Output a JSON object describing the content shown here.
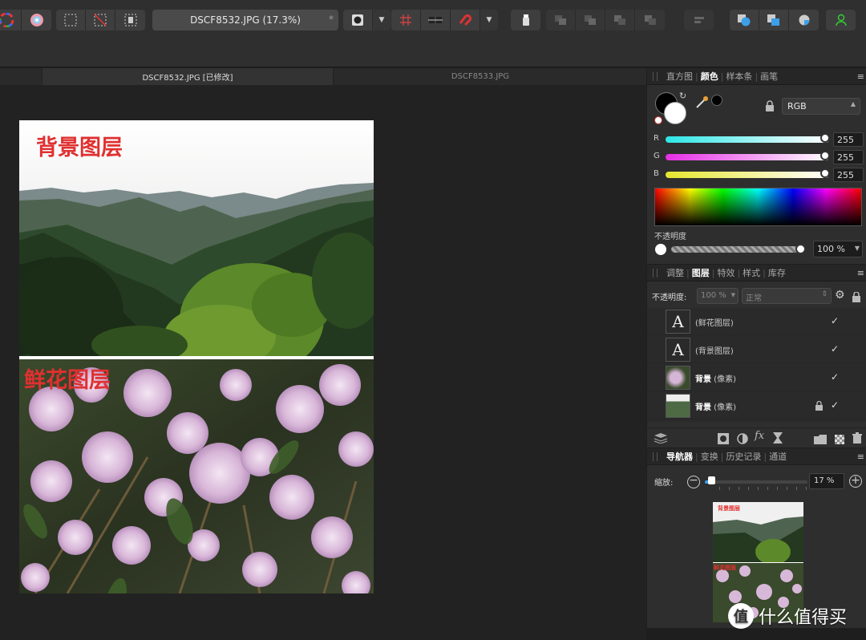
{
  "toolbar": {
    "document_title": "DSCF8532.JPG (17.3%)",
    "modified_mark": "*"
  },
  "tabs": [
    {
      "label": "DSCF8532.JPG [已修改]",
      "active": true
    },
    {
      "label": "DSCF8533.JPG",
      "active": false
    }
  ],
  "canvas": {
    "top_text_layer": "背景图层",
    "bottom_text_layer": "鲜花图层"
  },
  "color_panel": {
    "tabs": [
      "直方图",
      "颜色",
      "样本条",
      "画笔"
    ],
    "active_tab": "颜色",
    "mode": "RGB",
    "channels": [
      {
        "label": "R",
        "value": "255",
        "color": "#2ee6e6"
      },
      {
        "label": "G",
        "value": "255",
        "color": "#e62ee6"
      },
      {
        "label": "B",
        "value": "255",
        "color": "#e6e62e"
      }
    ],
    "opacity_label": "不透明度",
    "opacity_value": "100 %"
  },
  "layers_panel": {
    "tabs": [
      "调整",
      "图层",
      "特效",
      "样式",
      "库存"
    ],
    "active_tab": "图层",
    "opacity_label": "不透明度:",
    "opacity_value": "100 %",
    "blend_mode": "正常",
    "layers": [
      {
        "thumb": "A",
        "name": "(鲜花图层)",
        "type": "text",
        "visible": "✓",
        "locked": false
      },
      {
        "thumb": "A",
        "name": "(背景图层)",
        "type": "text",
        "visible": "✓",
        "locked": false
      },
      {
        "thumb": "",
        "bold": "背景",
        "name": " (像素)",
        "type": "flower",
        "visible": "✓",
        "locked": false
      },
      {
        "thumb": "",
        "bold": "背景",
        "name": " (像素)",
        "type": "mountain",
        "visible": "✓",
        "locked": true
      }
    ]
  },
  "navigator_panel": {
    "tabs": [
      "导航器",
      "变换",
      "历史记录",
      "通道"
    ],
    "active_tab": "导航器",
    "zoom_label": "缩放:",
    "zoom_value": "17 %",
    "zoom_level": 0.06,
    "thumb_top_text": "背景图层",
    "thumb_bottom_text": "鲜花图层"
  },
  "watermark": {
    "icon": "值",
    "text": "什么值得买"
  }
}
